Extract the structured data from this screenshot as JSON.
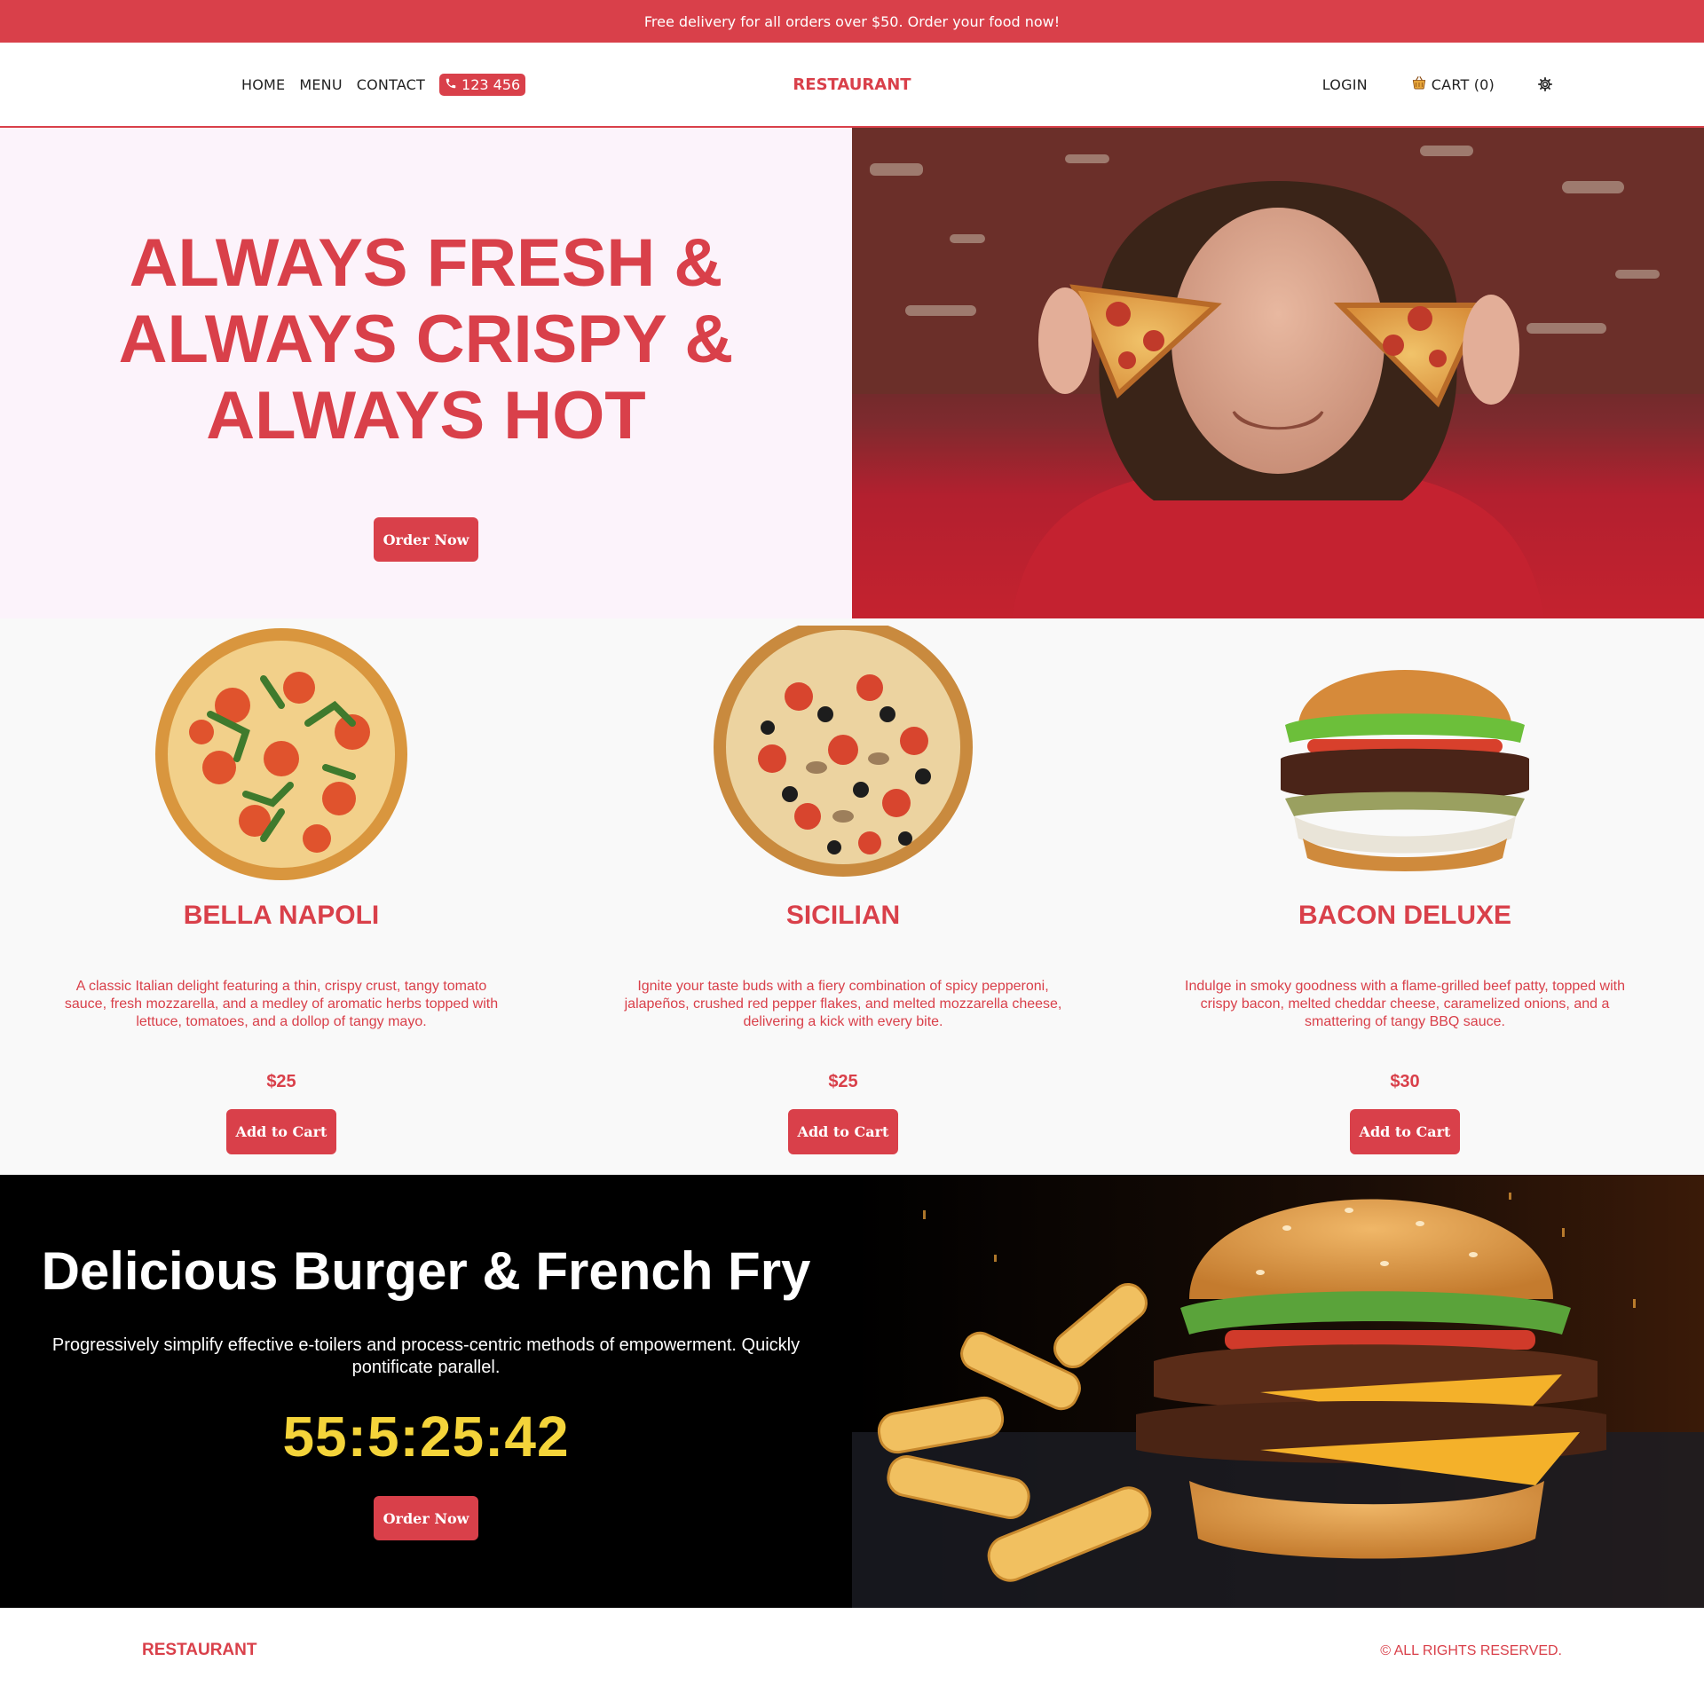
{
  "announcement": "Free delivery for all orders over $50. Order your food now!",
  "nav": {
    "links": [
      "HOME",
      "MENU",
      "CONTACT"
    ],
    "phone": "123 456",
    "brand": "RESTAURANT",
    "login": "LOGIN",
    "cart": "CART (0)"
  },
  "hero": {
    "title_lines": [
      "ALWAYS FRESH &",
      "ALWAYS CRISPY &",
      "ALWAYS HOT"
    ],
    "button": "Order Now"
  },
  "products": [
    {
      "name": "BELLA NAPOLI",
      "description": "A classic Italian delight featuring a thin, crispy crust, tangy tomato sauce, fresh mozzarella, and a medley of aromatic herbs topped with lettuce, tomatoes, and a dollop of tangy mayo.",
      "price": "$25",
      "button": "Add to Cart",
      "image": "pizza-margherita-arugula"
    },
    {
      "name": "SICILIAN",
      "description": "Ignite your taste buds with a fiery combination of spicy pepperoni, jalapeños, crushed red pepper flakes, and melted mozzarella cheese, delivering a kick with every bite.",
      "price": "$25",
      "button": "Add to Cart",
      "image": "pizza-olives-peppers"
    },
    {
      "name": "BACON DELUXE",
      "description": "Indulge in smoky goodness with a flame-grilled beef patty, topped with crispy bacon, melted cheddar cheese, caramelized onions, and a smattering of tangy BBQ sauce.",
      "price": "$30",
      "button": "Add to Cart",
      "image": "bacon-burger"
    }
  ],
  "promo": {
    "title": "Delicious Burger & French Fry",
    "text": "Progressively simplify effective e-toilers and process-centric methods of empowerment. Quickly pontificate parallel.",
    "countdown": "55:5:25:42",
    "button": "Order Now"
  },
  "footer": {
    "brand": "RESTAURANT",
    "copyright": "© ALL RIGHTS RESERVED."
  },
  "colors": {
    "accent": "#d9404a",
    "hero_bg": "#fcf3fb",
    "countdown": "#f4d43a"
  }
}
